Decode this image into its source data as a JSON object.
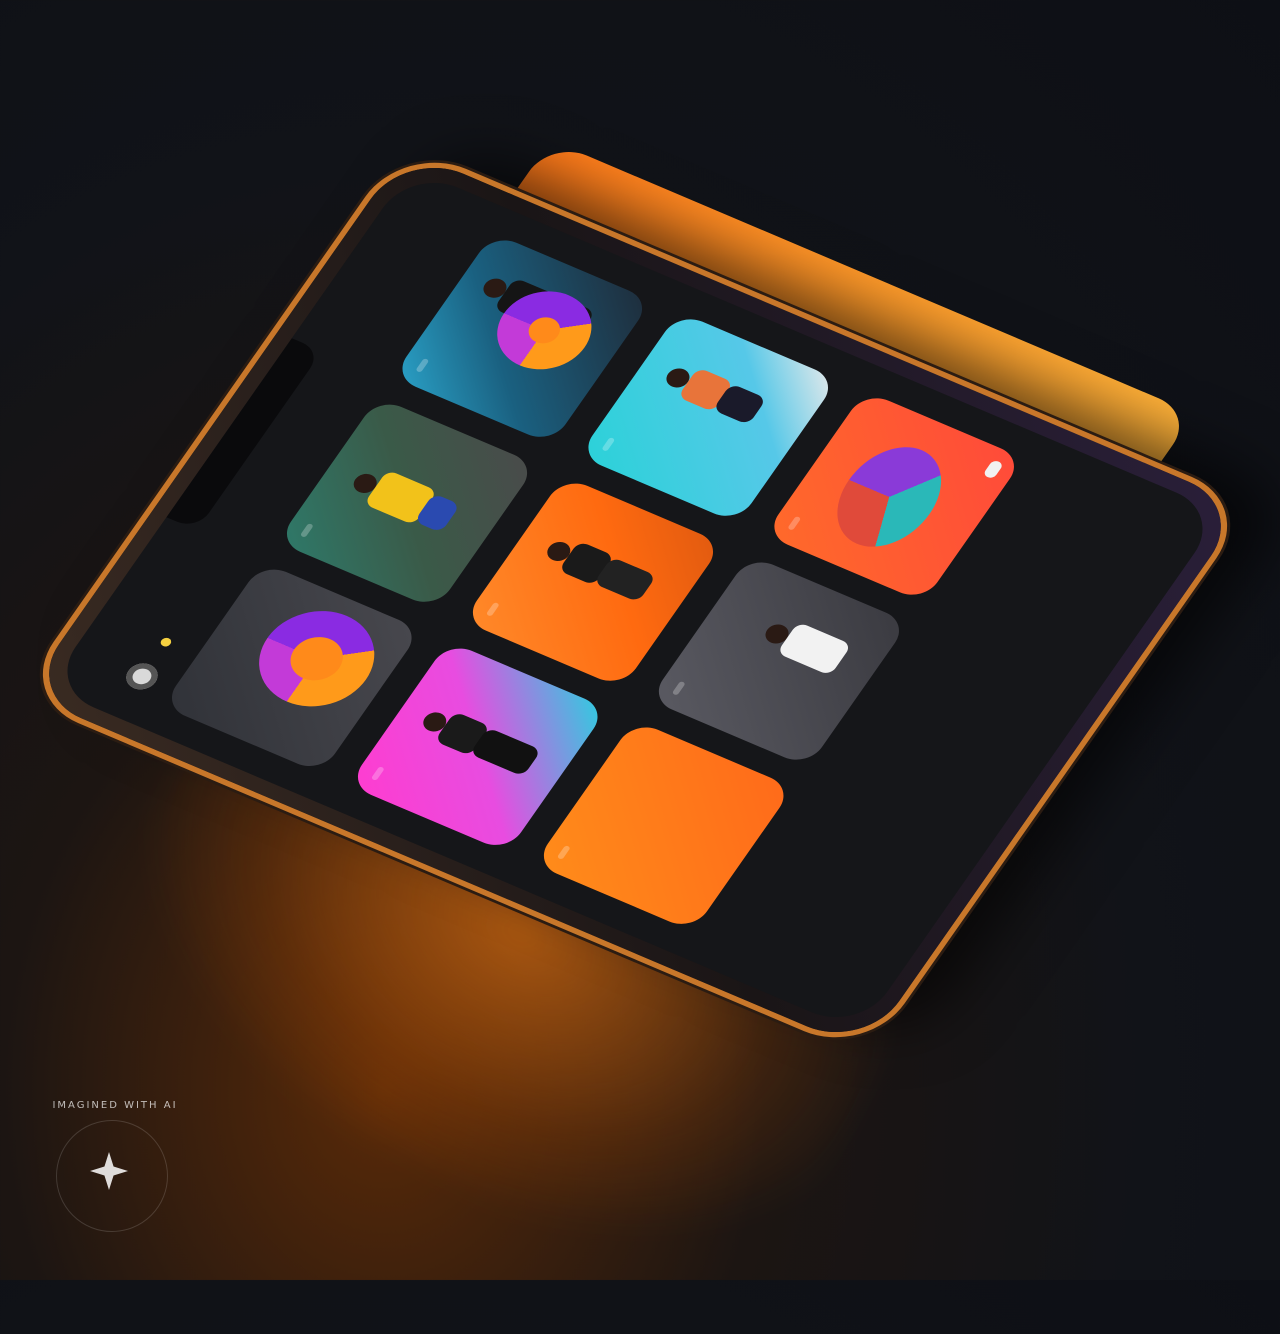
{
  "scene": {
    "accent_colors": [
      "#ff7a1a",
      "#c33ad8",
      "#2ad2d8",
      "#f5d040"
    ]
  },
  "status_bar": {
    "left": "",
    "right": ""
  },
  "header": {
    "title": "",
    "icons": [
      "avatar",
      "notification-dot"
    ]
  },
  "cards": [
    {
      "tag": "",
      "big_text": "",
      "style": "ring-chart",
      "icon": "ring-icon"
    },
    {
      "tag": "",
      "style": "athlete-yellow-shirt",
      "icon": "person-icon"
    },
    {
      "tag": "",
      "style": "athlete-black-outfit",
      "icon": "person-icon"
    },
    {
      "tag": "",
      "style": "athlete-pink-bg",
      "icon": "person-icon"
    },
    {
      "tag": "",
      "style": "athlete-orange-bg",
      "icon": "person-icon"
    },
    {
      "tag": "",
      "style": "athlete-cyan-bg",
      "icon": "person-icon"
    },
    {
      "tag": "",
      "style": "orange-promo",
      "icon": "none"
    },
    {
      "tag": "",
      "style": "athlete-grey-bg",
      "icon": "person-icon"
    },
    {
      "tag": "",
      "style": "pie-chart",
      "pill": "",
      "icon": "pie-icon"
    }
  ],
  "watermark": {
    "text": "IMAGINED WITH AI"
  }
}
